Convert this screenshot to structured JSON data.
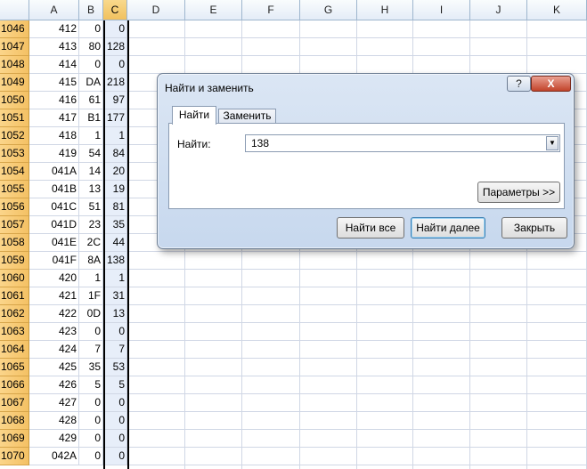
{
  "columns": [
    "A",
    "B",
    "C",
    "D",
    "E",
    "F",
    "G",
    "H",
    "I",
    "J",
    "K"
  ],
  "rows": [
    {
      "n": "1046",
      "a": "412",
      "b": "0",
      "c": "0"
    },
    {
      "n": "1047",
      "a": "413",
      "b": "80",
      "c": "128"
    },
    {
      "n": "1048",
      "a": "414",
      "b": "0",
      "c": "0"
    },
    {
      "n": "1049",
      "a": "415",
      "b": "DA",
      "c": "218"
    },
    {
      "n": "1050",
      "a": "416",
      "b": "61",
      "c": "97"
    },
    {
      "n": "1051",
      "a": "417",
      "b": "B1",
      "c": "177"
    },
    {
      "n": "1052",
      "a": "418",
      "b": "1",
      "c": "1"
    },
    {
      "n": "1053",
      "a": "419",
      "b": "54",
      "c": "84"
    },
    {
      "n": "1054",
      "a": "041A",
      "b": "14",
      "c": "20"
    },
    {
      "n": "1055",
      "a": "041B",
      "b": "13",
      "c": "19"
    },
    {
      "n": "1056",
      "a": "041C",
      "b": "51",
      "c": "81"
    },
    {
      "n": "1057",
      "a": "041D",
      "b": "23",
      "c": "35"
    },
    {
      "n": "1058",
      "a": "041E",
      "b": "2C",
      "c": "44"
    },
    {
      "n": "1059",
      "a": "041F",
      "b": "8A",
      "c": "138"
    },
    {
      "n": "1060",
      "a": "420",
      "b": "1",
      "c": "1"
    },
    {
      "n": "1061",
      "a": "421",
      "b": "1F",
      "c": "31"
    },
    {
      "n": "1062",
      "a": "422",
      "b": "0D",
      "c": "13"
    },
    {
      "n": "1063",
      "a": "423",
      "b": "0",
      "c": "0"
    },
    {
      "n": "1064",
      "a": "424",
      "b": "7",
      "c": "7"
    },
    {
      "n": "1065",
      "a": "425",
      "b": "35",
      "c": "53"
    },
    {
      "n": "1066",
      "a": "426",
      "b": "5",
      "c": "5"
    },
    {
      "n": "1067",
      "a": "427",
      "b": "0",
      "c": "0"
    },
    {
      "n": "1068",
      "a": "428",
      "b": "0",
      "c": "0"
    },
    {
      "n": "1069",
      "a": "429",
      "b": "0",
      "c": "0"
    },
    {
      "n": "1070",
      "a": "042A",
      "b": "0",
      "c": "0"
    }
  ],
  "dialog": {
    "title": "Найти и заменить",
    "help_glyph": "?",
    "close_glyph": "X",
    "tab_find": "Найти",
    "tab_replace": "Заменить",
    "find_label": "Найти:",
    "find_value": "138",
    "dropdown_glyph": "▼",
    "params_button": "Параметры >>",
    "find_all_button": "Найти все",
    "find_next_button": "Найти далее",
    "close_button": "Закрыть"
  }
}
